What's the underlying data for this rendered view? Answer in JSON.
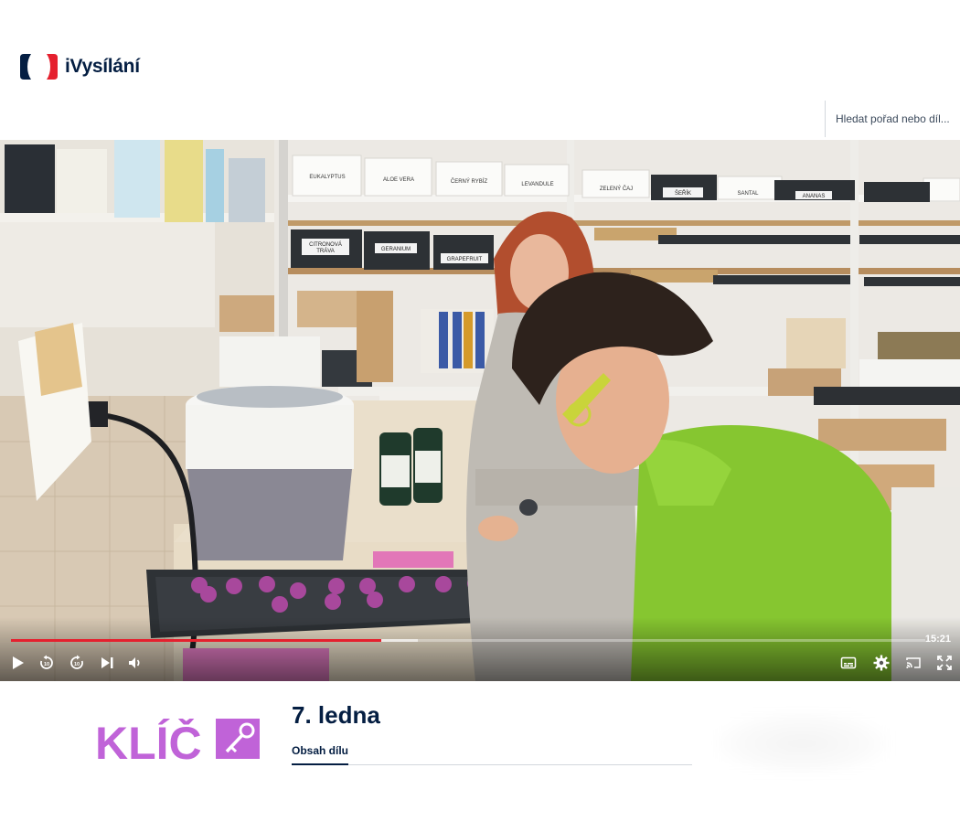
{
  "header": {
    "brand": "iVysílání",
    "search_placeholder": "Hledat pořad nebo díl..."
  },
  "video": {
    "shelf_labels": [
      "EUKALYPTUS",
      "ALOE VERA",
      "ČERNÝ RYBÍZ",
      "LEVANDULE",
      "ZELENÝ ČAJ",
      "ŠEŘÍK",
      "SANTAL",
      "ANANAS",
      "CITRONOVÁ TRÁVA",
      "GERANIUM",
      "GRAPEFRUIT"
    ],
    "duration": "15:21",
    "progress_played": 0.405,
    "progress_buffered": 0.445
  },
  "show": {
    "logo_text": "KLÍČ",
    "episode_title": "7. ledna",
    "tabs": [
      {
        "label": "Obsah dílu",
        "active": true
      }
    ]
  },
  "colors": {
    "brand_navy": "#041e42",
    "brand_red": "#e5202e",
    "show_purple": "#c063d8"
  }
}
